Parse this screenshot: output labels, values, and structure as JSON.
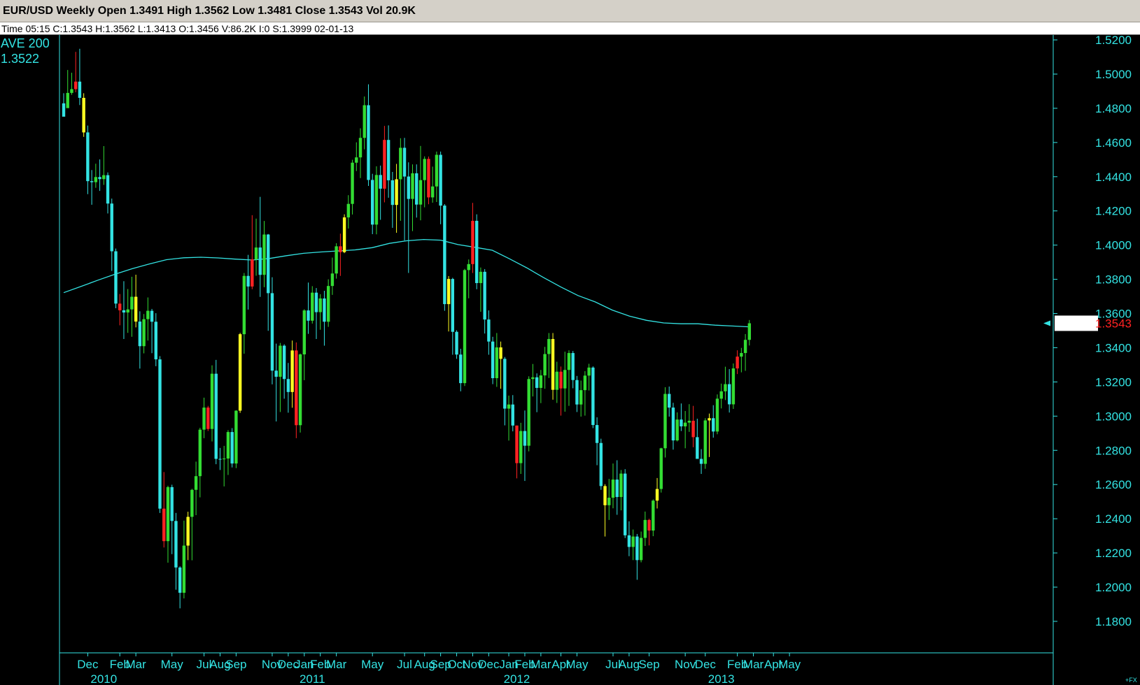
{
  "header": {
    "title": "EUR/USD Weekly Open 1.3491 High 1.3562 Low 1.3481 Close 1.3543 Vol 20.9K",
    "info": "Time 05:15  C:1.3543  H:1.3562  L:1.3413  O:1.3456  V:86.2K  I:0  S:1.3999  02-01-13"
  },
  "indicator": {
    "label": "AVE  200",
    "value": "1.3522"
  },
  "footer_mark": "+FX",
  "colors": {
    "background": "#000000",
    "axis": "#33e3e3",
    "bull": "#33e3e3",
    "bear": "#ff2222",
    "yellow": "#ffff22",
    "green": "#33dd33",
    "ma_line": "#33e3e3",
    "last_price_bg": "#ffffff",
    "last_price_text": "#ff2222"
  },
  "chart_data": {
    "type": "candlestick",
    "symbol": "EUR/USD",
    "timeframe": "Weekly",
    "ylim": [
      1.18,
      1.52
    ],
    "y_ticks": [
      "1.5200",
      "1.5000",
      "1.4800",
      "1.4600",
      "1.4400",
      "1.4200",
      "1.4000",
      "1.3800",
      "1.3600",
      "1.3400",
      "1.3200",
      "1.3000",
      "1.2800",
      "1.2600",
      "1.2400",
      "1.2200",
      "1.2000",
      "1.1800"
    ],
    "last_price_label": "1.3543",
    "x_months": [
      {
        "label": "Dec",
        "week": 6
      },
      {
        "label": "Feb",
        "week": 14
      },
      {
        "label": "Mar",
        "week": 18
      },
      {
        "label": "May",
        "week": 27
      },
      {
        "label": "Jul",
        "week": 35
      },
      {
        "label": "Aug",
        "week": 39
      },
      {
        "label": "Sep",
        "week": 43
      },
      {
        "label": "Nov",
        "week": 52
      },
      {
        "label": "Dec",
        "week": 56
      },
      {
        "label": "Jan",
        "week": 60
      },
      {
        "label": "Feb",
        "week": 64
      },
      {
        "label": "Mar",
        "week": 68
      },
      {
        "label": "May",
        "week": 77
      },
      {
        "label": "Jul",
        "week": 85
      },
      {
        "label": "Aug",
        "week": 90
      },
      {
        "label": "Sep",
        "week": 94
      },
      {
        "label": "Oct",
        "week": 98
      },
      {
        "label": "Nov",
        "week": 102
      },
      {
        "label": "Dec",
        "week": 106
      },
      {
        "label": "Jan",
        "week": 111
      },
      {
        "label": "Feb",
        "week": 115
      },
      {
        "label": "Mar",
        "week": 119
      },
      {
        "label": "Apr",
        "week": 124
      },
      {
        "label": "May",
        "week": 128
      },
      {
        "label": "Jul",
        "week": 137
      },
      {
        "label": "Aug",
        "week": 141
      },
      {
        "label": "Sep",
        "week": 146
      },
      {
        "label": "Nov",
        "week": 155
      },
      {
        "label": "Dec",
        "week": 160
      },
      {
        "label": "Feb",
        "week": 168
      },
      {
        "label": "Mar",
        "week": 172
      },
      {
        "label": "Apr",
        "week": 177
      },
      {
        "label": "May",
        "week": 181
      }
    ],
    "x_years": [
      {
        "label": "2010",
        "week": 10
      },
      {
        "label": "2011",
        "week": 62
      },
      {
        "label": "2012",
        "week": 113
      },
      {
        "label": "2013",
        "week": 164
      }
    ],
    "candles": [
      [
        1.4829,
        1.4751,
        1.4888,
        1.4801
      ],
      [
        1.4801,
        1.489,
        1.5024,
        1.4859
      ],
      [
        1.489,
        1.4912,
        1.5008,
        1.4879
      ],
      [
        1.4912,
        1.4956,
        1.513,
        1.4894
      ],
      [
        1.4956,
        1.4861,
        1.5148,
        1.4819
      ],
      [
        1.4861,
        1.4659,
        1.4888,
        1.4633
      ],
      [
        1.4659,
        1.4374,
        1.4699,
        1.4298
      ],
      [
        1.4374,
        1.4368,
        1.4439,
        1.4236
      ],
      [
        1.4368,
        1.4398,
        1.4476,
        1.4335
      ],
      [
        1.4398,
        1.4386,
        1.4501,
        1.4317
      ],
      [
        1.4386,
        1.4409,
        1.4579,
        1.4352
      ],
      [
        1.4409,
        1.4243,
        1.4425,
        1.4185
      ],
      [
        1.4243,
        1.3964,
        1.4272,
        1.3849
      ],
      [
        1.3964,
        1.3658,
        1.398,
        1.3631
      ],
      [
        1.3658,
        1.3619,
        1.3714,
        1.3531
      ],
      [
        1.3619,
        1.3606,
        1.3789,
        1.3451
      ],
      [
        1.3606,
        1.3624,
        1.3743,
        1.3487
      ],
      [
        1.3624,
        1.3698,
        1.3815,
        1.3464
      ],
      [
        1.3698,
        1.3553,
        1.3827,
        1.3519
      ],
      [
        1.3553,
        1.3409,
        1.3613,
        1.3278
      ],
      [
        1.3409,
        1.3567,
        1.3597,
        1.3367
      ],
      [
        1.3567,
        1.3616,
        1.3694,
        1.3442
      ],
      [
        1.3616,
        1.3552,
        1.3627,
        1.3368
      ],
      [
        1.3552,
        1.3332,
        1.3602,
        1.3292
      ],
      [
        1.3332,
        1.2459,
        1.3351,
        1.2434
      ],
      [
        1.2459,
        1.2269,
        1.2673,
        1.2232
      ],
      [
        1.2269,
        1.2585,
        1.2593,
        1.2143
      ],
      [
        1.2585,
        1.2387,
        1.2599,
        1.2193
      ],
      [
        1.2387,
        1.2115,
        1.2434,
        1.1985
      ],
      [
        1.2115,
        1.1967,
        1.2122,
        1.1876
      ],
      [
        1.1967,
        1.2243,
        1.2389,
        1.1934
      ],
      [
        1.2243,
        1.2411,
        1.2441,
        1.2158
      ],
      [
        1.2411,
        1.2569,
        1.2575,
        1.2157
      ],
      [
        1.2569,
        1.2649,
        1.2734,
        1.2421
      ],
      [
        1.2649,
        1.2921,
        1.2932,
        1.2525
      ],
      [
        1.2921,
        1.305,
        1.3108,
        1.2871
      ],
      [
        1.305,
        1.2925,
        1.306,
        1.2913
      ],
      [
        1.2925,
        1.3248,
        1.3297,
        1.2852
      ],
      [
        1.3248,
        1.275,
        1.3329,
        1.2719
      ],
      [
        1.275,
        1.2749,
        1.2814,
        1.2685
      ],
      [
        1.2749,
        1.2752,
        1.2826,
        1.2589
      ],
      [
        1.2752,
        1.2907,
        1.2918,
        1.2656
      ],
      [
        1.2907,
        1.2723,
        1.293,
        1.27
      ],
      [
        1.2723,
        1.3032,
        1.3034,
        1.2696
      ],
      [
        1.3032,
        1.3479,
        1.3487,
        1.3019
      ],
      [
        1.3479,
        1.382,
        1.3837,
        1.3365
      ],
      [
        1.382,
        1.3758,
        1.3943,
        1.3623
      ],
      [
        1.3758,
        1.3917,
        1.4175,
        1.3742
      ],
      [
        1.3917,
        1.3986,
        1.4155,
        1.3821
      ],
      [
        1.3986,
        1.3826,
        1.4282,
        1.3697
      ],
      [
        1.3826,
        1.4062,
        1.4141,
        1.3754
      ],
      [
        1.4062,
        1.3719,
        1.4065,
        1.3499
      ],
      [
        1.3719,
        1.3266,
        1.3812,
        1.3186
      ],
      [
        1.3266,
        1.323,
        1.3424,
        1.2969
      ],
      [
        1.323,
        1.3412,
        1.3428,
        1.3024
      ],
      [
        1.3412,
        1.3217,
        1.342,
        1.3102
      ],
      [
        1.3217,
        1.3141,
        1.3311,
        1.302
      ],
      [
        1.3141,
        1.3384,
        1.3442,
        1.3049
      ],
      [
        1.3384,
        1.2947,
        1.3431,
        1.2871
      ],
      [
        1.2947,
        1.3361,
        1.3366,
        1.2904
      ],
      [
        1.3361,
        1.3618,
        1.3625,
        1.321
      ],
      [
        1.3618,
        1.3558,
        1.3781,
        1.3481
      ],
      [
        1.3558,
        1.3722,
        1.376,
        1.3541
      ],
      [
        1.3722,
        1.3608,
        1.3749,
        1.3451
      ],
      [
        1.3608,
        1.3688,
        1.3713,
        1.3505
      ],
      [
        1.3688,
        1.3552,
        1.3733,
        1.3412
      ],
      [
        1.3552,
        1.3761,
        1.38,
        1.3522
      ],
      [
        1.3761,
        1.3834,
        1.3927,
        1.3709
      ],
      [
        1.3834,
        1.3993,
        1.4011,
        1.3804
      ],
      [
        1.3993,
        1.3959,
        1.4067,
        1.382
      ],
      [
        1.3959,
        1.4162,
        1.418,
        1.3953
      ],
      [
        1.4162,
        1.4241,
        1.4292,
        1.4097
      ],
      [
        1.4241,
        1.4482,
        1.4499,
        1.4179
      ],
      [
        1.4482,
        1.4513,
        1.4601,
        1.4433
      ],
      [
        1.4513,
        1.4627,
        1.4683,
        1.4392
      ],
      [
        1.4627,
        1.4818,
        1.4869,
        1.456
      ],
      [
        1.4818,
        1.4381,
        1.494,
        1.4346
      ],
      [
        1.4381,
        1.412,
        1.4417,
        1.4064
      ],
      [
        1.412,
        1.441,
        1.4461,
        1.4063
      ],
      [
        1.441,
        1.433,
        1.4465,
        1.4148
      ],
      [
        1.433,
        1.4615,
        1.4697,
        1.425
      ],
      [
        1.4615,
        1.4379,
        1.47,
        1.4277
      ],
      [
        1.4379,
        1.4235,
        1.4428,
        1.4101
      ],
      [
        1.4235,
        1.4385,
        1.4475,
        1.4072
      ],
      [
        1.4385,
        1.4569,
        1.4625,
        1.4142
      ],
      [
        1.4569,
        1.4401,
        1.4627,
        1.4027
      ],
      [
        1.4401,
        1.427,
        1.4484,
        1.3837
      ],
      [
        1.427,
        1.442,
        1.4472,
        1.4082
      ],
      [
        1.442,
        1.4237,
        1.4472,
        1.4161
      ],
      [
        1.4237,
        1.438,
        1.458,
        1.4145
      ],
      [
        1.438,
        1.4504,
        1.4519,
        1.4221
      ],
      [
        1.4504,
        1.4279,
        1.4518,
        1.4239
      ],
      [
        1.4279,
        1.4343,
        1.4459,
        1.4248
      ],
      [
        1.4343,
        1.4528,
        1.4547,
        1.4252
      ],
      [
        1.4528,
        1.4231,
        1.4547,
        1.4122
      ],
      [
        1.4231,
        1.3655,
        1.424,
        1.3616
      ],
      [
        1.3655,
        1.3802,
        1.3819,
        1.3495
      ],
      [
        1.3802,
        1.3493,
        1.3809,
        1.3359
      ],
      [
        1.3493,
        1.336,
        1.3502,
        1.3335
      ],
      [
        1.336,
        1.3193,
        1.3394,
        1.3145
      ],
      [
        1.3193,
        1.3854,
        1.3861,
        1.3176
      ],
      [
        1.3854,
        1.3889,
        1.3916,
        1.3689
      ],
      [
        1.3889,
        1.4142,
        1.4247,
        1.3837
      ],
      [
        1.4142,
        1.3778,
        1.418,
        1.3742
      ],
      [
        1.3778,
        1.3844,
        1.3869,
        1.361
      ],
      [
        1.3844,
        1.3565,
        1.386,
        1.3483
      ],
      [
        1.3565,
        1.3436,
        1.3618,
        1.3359
      ],
      [
        1.3436,
        1.3222,
        1.3464,
        1.3187
      ],
      [
        1.3222,
        1.3402,
        1.3486,
        1.3171
      ],
      [
        1.3402,
        1.3335,
        1.3436,
        1.316
      ],
      [
        1.3335,
        1.3044,
        1.3346,
        1.2946
      ],
      [
        1.3044,
        1.3068,
        1.312,
        1.2857
      ],
      [
        1.3068,
        1.2945,
        1.3123,
        1.2911
      ],
      [
        1.2945,
        1.2725,
        1.2945,
        1.2636
      ],
      [
        1.2725,
        1.2913,
        1.2961,
        1.2662
      ],
      [
        1.2913,
        1.2827,
        1.3033,
        1.2621
      ],
      [
        1.2827,
        1.3217,
        1.3233,
        1.2794
      ],
      [
        1.3217,
        1.3227,
        1.3305,
        1.3115
      ],
      [
        1.3227,
        1.3165,
        1.325,
        1.3023
      ],
      [
        1.3165,
        1.3238,
        1.327,
        1.3076
      ],
      [
        1.3238,
        1.3363,
        1.3405,
        1.316
      ],
      [
        1.3363,
        1.3451,
        1.3486,
        1.3223
      ],
      [
        1.3451,
        1.3154,
        1.3486,
        1.3096
      ],
      [
        1.3154,
        1.326,
        1.3318,
        1.3077
      ],
      [
        1.326,
        1.3162,
        1.329,
        1.3003
      ],
      [
        1.3162,
        1.327,
        1.3377,
        1.3026
      ],
      [
        1.327,
        1.3369,
        1.3385,
        1.306
      ],
      [
        1.3369,
        1.3211,
        1.3381,
        1.3163
      ],
      [
        1.3211,
        1.3068,
        1.3235,
        1.3024
      ],
      [
        1.3068,
        1.3152,
        1.3208,
        1.2997
      ],
      [
        1.3152,
        1.3237,
        1.3263,
        1.3003
      ],
      [
        1.3237,
        1.3284,
        1.3306,
        1.315
      ],
      [
        1.3284,
        1.2948,
        1.3291,
        1.293
      ],
      [
        1.2948,
        1.2843,
        1.2993,
        1.2713
      ],
      [
        1.2843,
        1.2591,
        1.2868,
        1.2569
      ],
      [
        1.2591,
        1.2479,
        1.2602,
        1.2296
      ],
      [
        1.2479,
        1.2523,
        1.2633,
        1.2393
      ],
      [
        1.2523,
        1.2629,
        1.2723,
        1.2461
      ],
      [
        1.2629,
        1.2527,
        1.2742,
        1.2423
      ],
      [
        1.2527,
        1.2664,
        1.2685,
        1.2449
      ],
      [
        1.2664,
        1.2303,
        1.269,
        1.2287
      ],
      [
        1.2303,
        1.2235,
        1.2385,
        1.2181
      ],
      [
        1.2235,
        1.2296,
        1.2337,
        1.2158
      ],
      [
        1.2296,
        1.2158,
        1.2311,
        1.2043
      ],
      [
        1.2158,
        1.2288,
        1.2325,
        1.2145
      ],
      [
        1.2288,
        1.2393,
        1.2442,
        1.2241
      ],
      [
        1.2393,
        1.2331,
        1.24,
        1.2244
      ],
      [
        1.2331,
        1.2506,
        1.2513,
        1.2298
      ],
      [
        1.2506,
        1.2574,
        1.2638,
        1.246
      ],
      [
        1.2574,
        1.2812,
        1.2815,
        1.2553
      ],
      [
        1.2812,
        1.313,
        1.3169,
        1.2758
      ],
      [
        1.313,
        1.305,
        1.3173,
        1.2997
      ],
      [
        1.305,
        1.2858,
        1.3078,
        1.2804
      ],
      [
        1.2858,
        1.298,
        1.3022,
        1.2852
      ],
      [
        1.298,
        1.294,
        1.3074,
        1.2913
      ],
      [
        1.294,
        1.2962,
        1.303,
        1.2812
      ],
      [
        1.2962,
        1.2973,
        1.307,
        1.2908
      ],
      [
        1.2973,
        1.2877,
        1.306,
        1.2818
      ],
      [
        1.2877,
        1.275,
        1.2985,
        1.276
      ],
      [
        1.275,
        1.2721,
        1.2807,
        1.2662
      ],
      [
        1.2721,
        1.2975,
        1.2988,
        1.2692
      ],
      [
        1.2975,
        1.2988,
        1.3015,
        1.2761
      ],
      [
        1.2988,
        1.291,
        1.3064,
        1.2874
      ],
      [
        1.291,
        1.3102,
        1.3127,
        1.2894
      ],
      [
        1.3102,
        1.3145,
        1.319,
        1.3045
      ],
      [
        1.3145,
        1.3187,
        1.3289,
        1.3094
      ],
      [
        1.3187,
        1.3069,
        1.3275,
        1.3021
      ],
      [
        1.3069,
        1.3279,
        1.3308,
        1.3042
      ],
      [
        1.3279,
        1.3348,
        1.3385,
        1.3246
      ],
      [
        1.3348,
        1.3369,
        1.3399,
        1.3256
      ],
      [
        1.3369,
        1.3446,
        1.348,
        1.3265
      ],
      [
        1.3446,
        1.3543,
        1.3562,
        1.3413
      ]
    ],
    "ma200": [
      1.3722,
      1.3758,
      1.3795,
      1.383,
      1.3862,
      1.389,
      1.3915,
      1.3926,
      1.3929,
      1.3925,
      1.3918,
      1.3913,
      1.3922,
      1.3938,
      1.3952,
      1.396,
      1.3966,
      1.3972,
      1.3985,
      1.401,
      1.4025,
      1.4033,
      1.4029,
      1.4003,
      1.3987,
      1.397,
      1.392,
      1.3868,
      1.381,
      1.3755,
      1.3705,
      1.3668,
      1.362,
      1.3585,
      1.356,
      1.3545,
      1.354,
      1.354,
      1.3532,
      1.3527,
      1.3522
    ]
  }
}
